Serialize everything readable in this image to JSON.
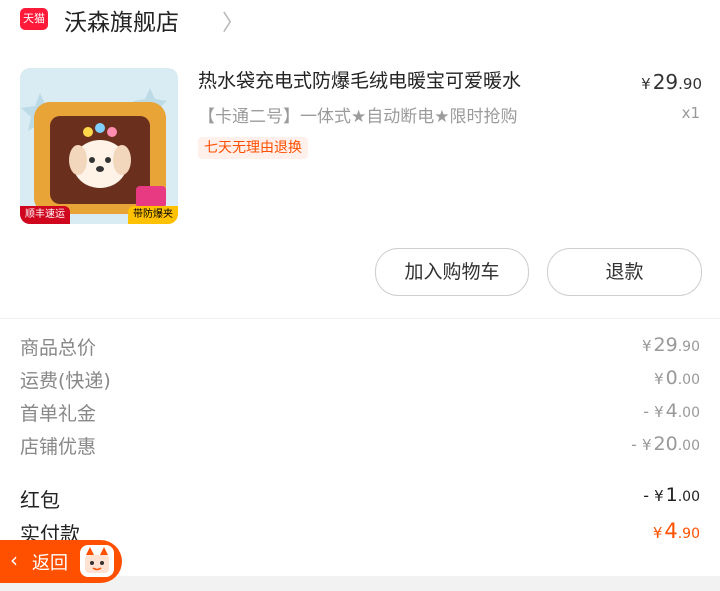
{
  "store": {
    "badge": "天猫",
    "name": "沃森旗舰店",
    "chevron": "〉"
  },
  "product": {
    "title": "热水袋充电式防爆毛绒电暖宝可爱暖水",
    "spec": "【卡通二号】一体式★自动断电★限时抢购",
    "promo_tag": "七天无理由退换",
    "price": {
      "currency": "¥",
      "integer": "29",
      "decimal": ".90"
    },
    "quantity": "x1",
    "image_tags": {
      "left": "顺丰速运",
      "right": "带防爆夹"
    }
  },
  "actions": {
    "add_to_cart": "加入购物车",
    "refund": "退款"
  },
  "summary": [
    {
      "label": "商品总价",
      "sign": "",
      "currency": "¥",
      "integer": "29",
      "decimal": ".90"
    },
    {
      "label": "运费(快递)",
      "sign": "",
      "currency": "¥",
      "integer": "0",
      "decimal": ".00"
    },
    {
      "label": "首单礼金",
      "sign": "- ",
      "currency": "¥",
      "integer": "4",
      "decimal": ".00"
    },
    {
      "label": "店铺优惠",
      "sign": "- ",
      "currency": "¥",
      "integer": "20",
      "decimal": ".00"
    },
    {
      "label": "红包",
      "sign": "- ",
      "currency": "¥",
      "integer": "1",
      "decimal": ".00"
    },
    {
      "label": "实付款",
      "sign": "",
      "currency": "¥",
      "integer": "4",
      "decimal": ".90"
    }
  ],
  "back_button": {
    "label": "返回"
  },
  "colors": {
    "accent": "#ff5000",
    "tmall_red": "#ff1a3a"
  }
}
